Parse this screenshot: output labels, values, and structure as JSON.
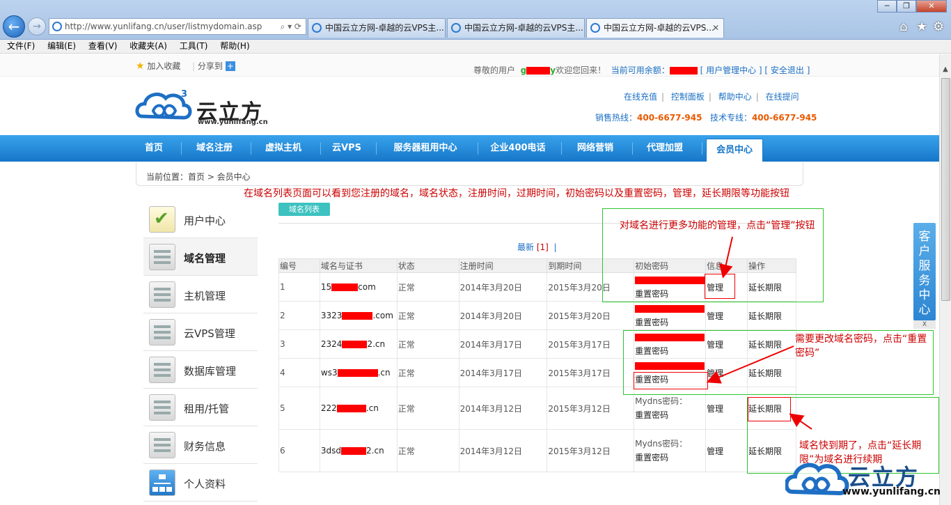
{
  "browser": {
    "address": "http://www.yunlifang.cn/user/listmydomain.asp",
    "tabs": [
      "中国云立方网-卓越的云VPS主...",
      "中国云立方网-卓越的云VPS主...",
      "中国云立方网-卓越的云VPS..."
    ],
    "menu": [
      "文件(F)",
      "编辑(E)",
      "查看(V)",
      "收藏夹(A)",
      "工具(T)",
      "帮助(H)"
    ]
  },
  "topbar": {
    "favorite": "加入收藏",
    "share": "分享到",
    "greeting_prefix": "尊敬的用户",
    "greeting_user": "g",
    "greeting_user_tail": "y",
    "welcome": "欢迎您回来！",
    "balance_label": "当前可用余额：",
    "balance_tail": "[",
    "user_center": "用户管理中心 ]",
    "logout": "[ 安全退出 ]"
  },
  "header": {
    "logo_text": "云立方",
    "logo_url": "www.yunlifang.cn",
    "links": [
      "在线充值",
      "控制面板",
      "帮助中心",
      "在线提问"
    ],
    "sales_label": "销售热线：",
    "sales_phone": "400-6677-945",
    "tech_label": "技术专线：",
    "tech_phone": "400-6677-945"
  },
  "nav": [
    "首页",
    "域名注册",
    "虚拟主机",
    "云VPS",
    "服务器租用中心",
    "企业400电话",
    "网络营销",
    "代理加盟",
    "会员中心"
  ],
  "breadcrumb": "当前位置：首页 > 会员中心",
  "sidebar": [
    "用户中心",
    "域名管理",
    "主机管理",
    "云VPS管理",
    "数据库管理",
    "租用/托管",
    "财务信息",
    "个人资料"
  ],
  "content": {
    "tab_label": "域名列表",
    "pager_text": "最新",
    "pager_page": "[1]",
    "pager_sep": "|",
    "columns": [
      "编号",
      "域名与证书",
      "状态",
      "注册时间",
      "到期时间",
      "初始密码",
      "信息",
      "操作"
    ],
    "rows": [
      {
        "id": "1",
        "domain_a": "15",
        "domain_b": "com",
        "status": "正常",
        "reg": "2014年3月20日",
        "exp": "2015年3月20日",
        "pw_top": "",
        "pw_reset": "重置密码",
        "info": "管理",
        "op": "延长期限"
      },
      {
        "id": "2",
        "domain_a": "3323",
        "domain_b": ".com",
        "status": "正常",
        "reg": "2014年3月20日",
        "exp": "2015年3月20日",
        "pw_top": "",
        "pw_reset": "重置密码",
        "info": "管理",
        "op": "延长期限"
      },
      {
        "id": "3",
        "domain_a": "2324",
        "domain_b": "2.cn",
        "status": "正常",
        "reg": "2014年3月17日",
        "exp": "2015年3月17日",
        "pw_top": "",
        "pw_reset": "重置密码",
        "info": "管理",
        "op": "延长期限"
      },
      {
        "id": "4",
        "domain_a": "ws3",
        "domain_b": ".cn",
        "status": "正常",
        "reg": "2014年3月17日",
        "exp": "2015年3月17日",
        "pw_top": "",
        "pw_reset": "重置密码",
        "info": "管理",
        "op": "延长期限"
      },
      {
        "id": "5",
        "domain_a": "222",
        "domain_b": ".cn",
        "status": "正常",
        "reg": "2014年3月12日",
        "exp": "2015年3月12日",
        "pw_top": "Mydns密码：",
        "pw_reset": "重置密码",
        "info": "管理",
        "op": "延长期限"
      },
      {
        "id": "6",
        "domain_a": "3dsd",
        "domain_b": "2.cn",
        "status": "正常",
        "reg": "2014年3月12日",
        "exp": "2015年3月12日",
        "pw_top": "Mydns密码：",
        "pw_reset": "重置密码",
        "info": "管理",
        "op": "延长期限"
      }
    ]
  },
  "annotations": {
    "top": "在域名列表页面可以看到您注册的域名，域名状态，注册时间，过期时间，初始密码以及重置密码，管理，延长期限等功能按钮",
    "manage": "对域名进行更多功能的管理，点击“管理”按钮",
    "reset": "需要更改域名密码，点击“重置密码”",
    "renew": "域名快到期了，点击“延长期限”为域名进行续期"
  },
  "service_panel": {
    "label": "客户服务中心",
    "close": "X"
  },
  "watermark": {
    "text": "云立方",
    "url": "www.yunlifang.cn"
  },
  "colors": {
    "nav_blue": "#1676c8",
    "accent_orange": "#e85a00",
    "annotation_red": "#cc0000",
    "annotation_green": "#2ec52e"
  }
}
